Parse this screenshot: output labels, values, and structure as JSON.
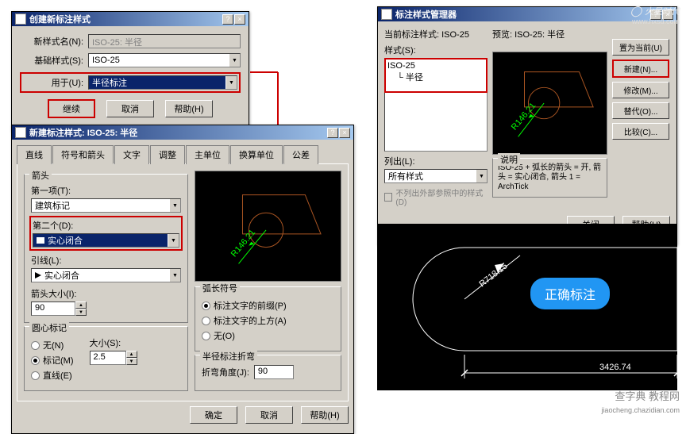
{
  "watermarks": {
    "logo": "火星时代",
    "url": "www.hxsd.com",
    "footer1": "查字典 教程网",
    "footer2": "jiaocheng.chazidian.com"
  },
  "dialog1": {
    "title": "创建新标注样式",
    "name_label": "新样式名(N):",
    "name_value": "ISO-25: 半径",
    "base_label": "基础样式(S):",
    "base_value": "ISO-25",
    "use_label": "用于(U):",
    "use_value": "半径标注",
    "btn_continue": "继续",
    "btn_cancel": "取消",
    "btn_help": "帮助(H)"
  },
  "dialog2": {
    "title": "新建标注样式: ISO-25: 半径",
    "tabs": [
      "直线",
      "符号和箭头",
      "文字",
      "调整",
      "主单位",
      "换算单位",
      "公差"
    ],
    "group_arrow": "箭头",
    "first_label": "第一项(T):",
    "first_value": "建筑标记",
    "second_label": "第二个(D):",
    "second_value": "实心闭合",
    "leader_label": "引线(L):",
    "leader_value": "实心闭合",
    "size_label": "箭头大小(I):",
    "size_value": "90",
    "group_center": "圆心标记",
    "radio_none": "无(N)",
    "radio_mark": "标记(M)",
    "radio_line": "直线(E)",
    "size_s_label": "大小(S):",
    "size_s_value": "2.5",
    "group_arc": "弧长符号",
    "radio_before": "标注文字的前缀(P)",
    "radio_above": "标注文字的上方(A)",
    "radio_arc_none": "无(O)",
    "group_radius": "半径标注折弯",
    "angle_label": "折弯角度(J):",
    "angle_value": "90",
    "btn_ok": "确定",
    "btn_cancel": "取消",
    "btn_help": "帮助(H)",
    "preview_text": "R146.21"
  },
  "dialog3": {
    "title": "标注样式管理器",
    "current_label": "当前标注样式: ISO-25",
    "styles_label": "样式(S):",
    "style_item1": "ISO-25",
    "style_item2": "半径",
    "list_label": "列出(L):",
    "list_value": "所有样式",
    "checkbox": "不列出外部参照中的样式(D)",
    "preview_label": "预览: ISO-25: 半径",
    "desc_label": "说明",
    "desc_text": "ISO-25 + 弧长的箭头 = 开, 箭头 = 实心闭合, 箭头 1 = ArchTick",
    "btn_setcurrent": "置为当前(U)",
    "btn_new": "新建(N)...",
    "btn_modify": "修改(M)...",
    "btn_override": "替代(O)...",
    "btn_compare": "比较(C)...",
    "btn_close": "关闭",
    "btn_help": "帮助(H)",
    "preview_text": "R146.21"
  },
  "result": {
    "badge": "正确标注",
    "dim1": "R718.15",
    "dim2": "3426.74"
  }
}
